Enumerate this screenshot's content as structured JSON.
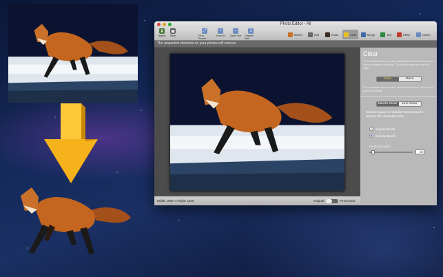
{
  "window": {
    "title": "Photo Editor - All"
  },
  "toolbar": {
    "left_buttons": [
      {
        "label": "Import",
        "icon": "import-icon"
      },
      {
        "label": "Save",
        "icon": "save-icon"
      },
      {
        "label": "Fit to Screen",
        "icon": "fit-icon"
      },
      {
        "label": "Zoom In",
        "icon": "zoom-in-icon"
      },
      {
        "label": "Zoom Out",
        "icon": "zoom-out-icon"
      },
      {
        "label": "Original size",
        "icon": "original-size-icon"
      }
    ],
    "tabs": [
      {
        "label": "Border",
        "icon": "border-icon"
      },
      {
        "label": "Edit",
        "icon": "edit-icon"
      },
      {
        "label": "Erase",
        "icon": "erase-icon"
      },
      {
        "label": "Clear",
        "icon": "clear-icon",
        "active": true
      },
      {
        "label": "Merge",
        "icon": "merge-icon"
      },
      {
        "label": "Text",
        "icon": "text-icon"
      },
      {
        "label": "Effect",
        "icon": "effect-icon"
      },
      {
        "label": "Distort",
        "icon": "distort-icon"
      }
    ]
  },
  "hint": "The unwanted elements on your photos will remove",
  "status": {
    "size": "Width: 1600 × Height: 1200",
    "original": "Original",
    "processed": "Processed"
  },
  "panel": {
    "title": "Clear",
    "desc": "The unwanted area on your photos will remove, at the area does not display anything. Choose the area you want to clear.",
    "mode_clear": "Clear",
    "mode_move": "Move",
    "desc2": "The unwanted area on your photos will remove, at the area does not display.",
    "tab_mouse": "Mouse Clear",
    "tab_line": "Line Clear",
    "brush_desc": "Choose square or circular mouse area to remove the unwanted area.",
    "square_brush": "Square Brush",
    "circular_brush": "Circular Brush",
    "brush_diameter": "Brush Diameter",
    "brush_value": "10"
  },
  "colors": {
    "arrow": "#f6b21a",
    "active_tab": "#9b9b9b",
    "yellow_text": "#e8d24a"
  }
}
